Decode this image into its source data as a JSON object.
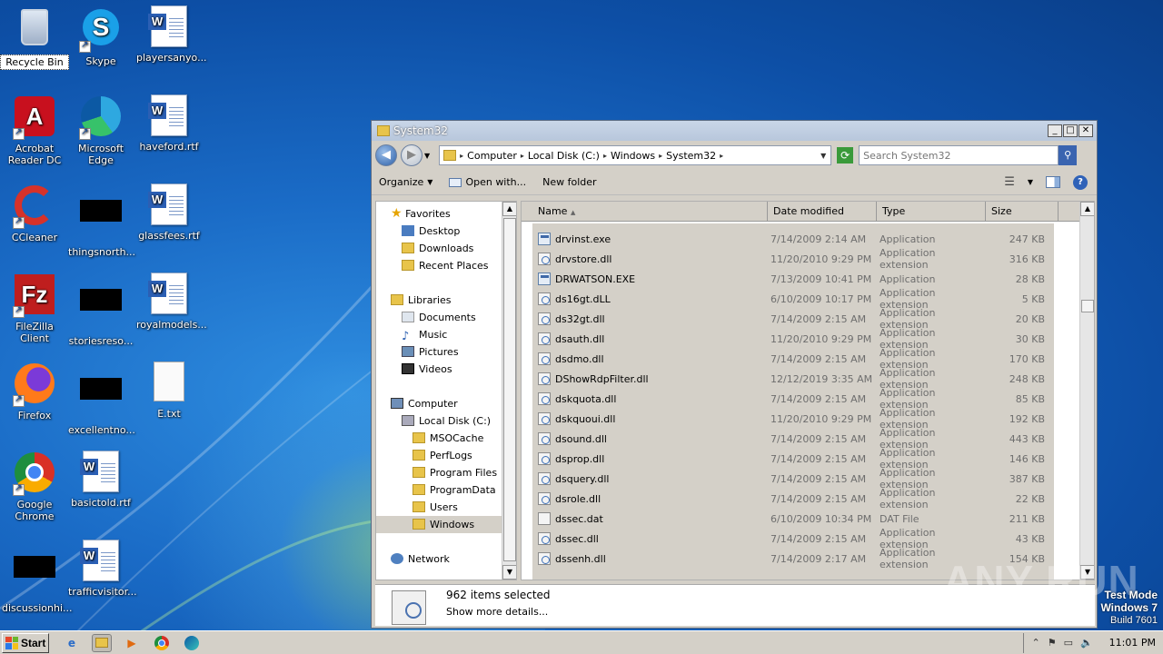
{
  "desktop": {
    "icons": [
      {
        "label": "Recycle Bin",
        "icon": "recycle-bin-icon"
      },
      {
        "label": "Skype",
        "icon": "skype-icon"
      },
      {
        "label": "playersanyo...",
        "icon": "word-doc-icon"
      },
      {
        "label": "Acrobat Reader DC",
        "icon": "acrobat-icon"
      },
      {
        "label": "Microsoft Edge",
        "icon": "edge-icon"
      },
      {
        "label": "haveford.rtf",
        "icon": "word-doc-icon"
      },
      {
        "label": "CCleaner",
        "icon": "ccleaner-icon"
      },
      {
        "label": "thingsnorth...",
        "icon": "redacted-icon"
      },
      {
        "label": "glassfees.rtf",
        "icon": "word-doc-icon"
      },
      {
        "label": "FileZilla Client",
        "icon": "filezilla-icon"
      },
      {
        "label": "storiesreso...",
        "icon": "redacted-icon"
      },
      {
        "label": "royalmodels...",
        "icon": "word-doc-icon"
      },
      {
        "label": "Firefox",
        "icon": "firefox-icon"
      },
      {
        "label": "excellentno...",
        "icon": "redacted-icon"
      },
      {
        "label": "E.txt",
        "icon": "text-file-icon"
      },
      {
        "label": "Google Chrome",
        "icon": "chrome-icon"
      },
      {
        "label": "basictold.rtf",
        "icon": "word-doc-icon"
      },
      {
        "label": "discussionhi...",
        "icon": "redacted-icon"
      },
      {
        "label": "trafficvisitor...",
        "icon": "word-doc-icon"
      }
    ]
  },
  "window": {
    "title": "System32",
    "breadcrumb": [
      "Computer",
      "Local Disk (C:)",
      "Windows",
      "System32"
    ],
    "search_placeholder": "Search System32",
    "toolbar": {
      "organize": "Organize",
      "open_with": "Open with...",
      "new_folder": "New folder"
    },
    "nav": {
      "favorites": "Favorites",
      "desktop": "Desktop",
      "downloads": "Downloads",
      "recent": "Recent Places",
      "libraries": "Libraries",
      "documents": "Documents",
      "music": "Music",
      "pictures": "Pictures",
      "videos": "Videos",
      "computer": "Computer",
      "local_disk": "Local Disk (C:)",
      "msocache": "MSOCache",
      "perflogs": "PerfLogs",
      "program_files": "Program Files",
      "programdata": "ProgramData",
      "users": "Users",
      "windows": "Windows",
      "network": "Network"
    },
    "columns": {
      "name": "Name",
      "date": "Date modified",
      "type": "Type",
      "size": "Size"
    },
    "files": [
      {
        "name": "drvinst.exe",
        "date": "7/14/2009 2:14 AM",
        "type": "Application",
        "size": "247 KB",
        "kind": "exe"
      },
      {
        "name": "drvstore.dll",
        "date": "11/20/2010 9:29 PM",
        "type": "Application extension",
        "size": "316 KB",
        "kind": "dll"
      },
      {
        "name": "DRWATSON.EXE",
        "date": "7/13/2009 10:41 PM",
        "type": "Application",
        "size": "28 KB",
        "kind": "exe"
      },
      {
        "name": "ds16gt.dLL",
        "date": "6/10/2009 10:17 PM",
        "type": "Application extension",
        "size": "5 KB",
        "kind": "dll"
      },
      {
        "name": "ds32gt.dll",
        "date": "7/14/2009 2:15 AM",
        "type": "Application extension",
        "size": "20 KB",
        "kind": "dll"
      },
      {
        "name": "dsauth.dll",
        "date": "11/20/2010 9:29 PM",
        "type": "Application extension",
        "size": "30 KB",
        "kind": "dll"
      },
      {
        "name": "dsdmo.dll",
        "date": "7/14/2009 2:15 AM",
        "type": "Application extension",
        "size": "170 KB",
        "kind": "dll"
      },
      {
        "name": "DShowRdpFilter.dll",
        "date": "12/12/2019 3:35 AM",
        "type": "Application extension",
        "size": "248 KB",
        "kind": "dll"
      },
      {
        "name": "dskquota.dll",
        "date": "7/14/2009 2:15 AM",
        "type": "Application extension",
        "size": "85 KB",
        "kind": "dll"
      },
      {
        "name": "dskquoui.dll",
        "date": "11/20/2010 9:29 PM",
        "type": "Application extension",
        "size": "192 KB",
        "kind": "dll"
      },
      {
        "name": "dsound.dll",
        "date": "7/14/2009 2:15 AM",
        "type": "Application extension",
        "size": "443 KB",
        "kind": "dll"
      },
      {
        "name": "dsprop.dll",
        "date": "7/14/2009 2:15 AM",
        "type": "Application extension",
        "size": "146 KB",
        "kind": "dll"
      },
      {
        "name": "dsquery.dll",
        "date": "7/14/2009 2:15 AM",
        "type": "Application extension",
        "size": "387 KB",
        "kind": "dll"
      },
      {
        "name": "dsrole.dll",
        "date": "7/14/2009 2:15 AM",
        "type": "Application extension",
        "size": "22 KB",
        "kind": "dll"
      },
      {
        "name": "dssec.dat",
        "date": "6/10/2009 10:34 PM",
        "type": "DAT File",
        "size": "211 KB",
        "kind": "dat"
      },
      {
        "name": "dssec.dll",
        "date": "7/14/2009 2:15 AM",
        "type": "Application extension",
        "size": "43 KB",
        "kind": "dll"
      },
      {
        "name": "dssenh.dll",
        "date": "7/14/2009 2:17 AM",
        "type": "Application extension",
        "size": "154 KB",
        "kind": "dll"
      }
    ],
    "details": {
      "count": "962 items selected",
      "more": "Show more details..."
    }
  },
  "watermark": "ANY RUN",
  "testmode": {
    "line1": "Test Mode",
    "line2": "Windows 7",
    "line3": "Build 7601"
  },
  "taskbar": {
    "start": "Start",
    "clock": "11:01 PM"
  }
}
